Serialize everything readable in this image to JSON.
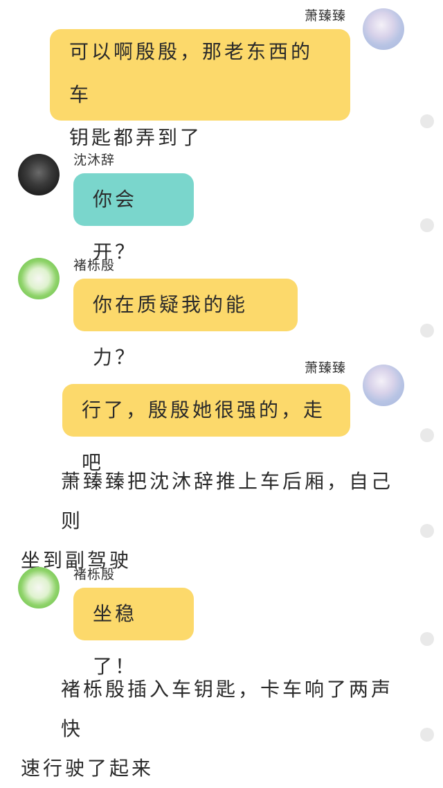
{
  "messages": [
    {
      "speaker": "萧臻臻",
      "text": "可以啊殷殷，那老东西的车钥匙都弄到了",
      "line1": "可以啊殷殷，那老东西的车",
      "line2": "钥匙都弄到了"
    },
    {
      "speaker": "沈沐辞",
      "text": "你会开？"
    },
    {
      "speaker": "褚栎殷",
      "text": "你在质疑我的能力？"
    },
    {
      "speaker": "萧臻臻",
      "text": "行了，殷殷她很强的，走吧"
    },
    {
      "speaker": "褚栎殷",
      "text": "坐稳了！"
    }
  ],
  "narration": [
    {
      "line1": "萧臻臻把沈沐辞推上车后厢，自己则",
      "line2": "坐到副驾驶"
    },
    {
      "line1": "褚栎殷插入车钥匙，卡车响了两声快",
      "line2": "速行驶了起来"
    }
  ],
  "colors": {
    "bubble_yellow": "#fcd96b",
    "bubble_teal": "#7ad6cc",
    "background": "#ffffff"
  },
  "icons": [
    "avatar-xiao-zhenzhen",
    "avatar-shen-muci",
    "avatar-chu-liyin",
    "read-indicator-dot"
  ]
}
